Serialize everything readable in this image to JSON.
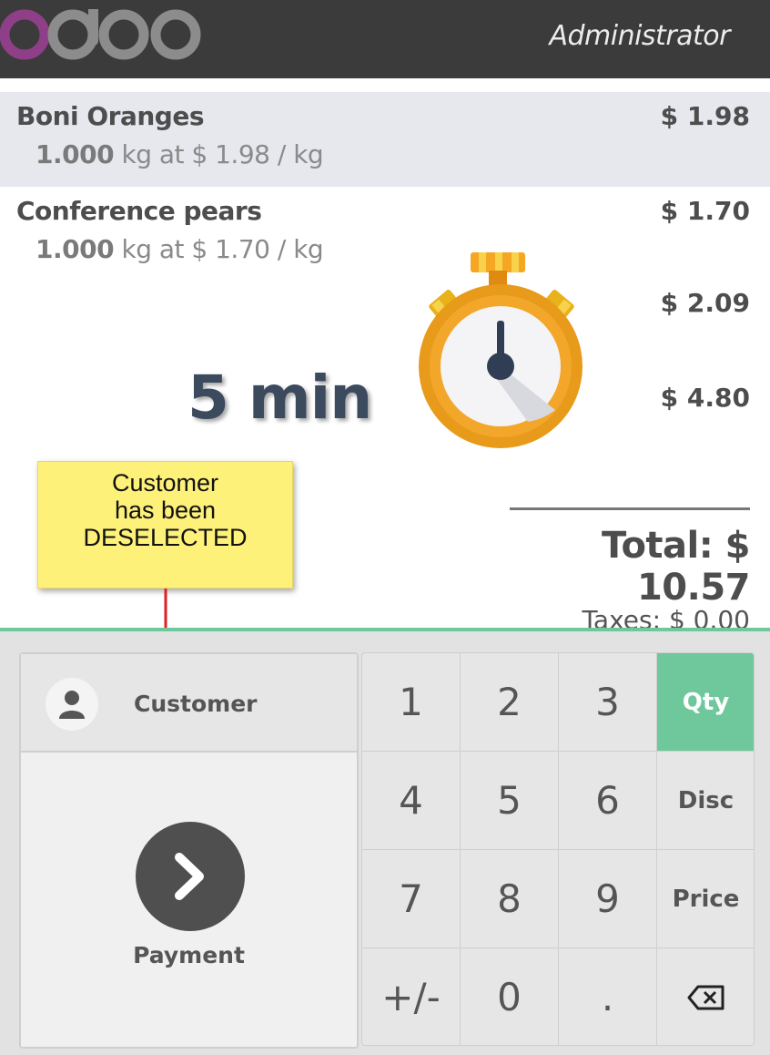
{
  "header": {
    "brand": "odoo",
    "user": "Administrator"
  },
  "order": {
    "lines": [
      {
        "name": "Boni Oranges",
        "price": "$ 1.98",
        "qty": "1.000",
        "detail": " kg at $ 1.98 / kg",
        "selected": true
      },
      {
        "name": "Conference pears",
        "price": "$ 1.70",
        "qty": "1.000",
        "detail": " kg at $ 1.70 / kg",
        "selected": false
      }
    ],
    "extra_prices": [
      "$ 2.09",
      "$ 4.80"
    ],
    "total": "Total: $ 10.57",
    "taxes": "Taxes: $ 0.00"
  },
  "overlay": {
    "time_text": "5 min",
    "note": "Customer\nhas been\nDESELECTED"
  },
  "actions": {
    "customer_label": "Customer",
    "payment_label": "Payment"
  },
  "numpad": {
    "keys": [
      [
        "1",
        "2",
        "3",
        "Qty"
      ],
      [
        "4",
        "5",
        "6",
        "Disc"
      ],
      [
        "7",
        "8",
        "9",
        "Price"
      ],
      [
        "+/-",
        "0",
        ".",
        "⌫"
      ]
    ],
    "active_mode": "Qty"
  },
  "colors": {
    "accent": "#6ec89b",
    "topbar": "#3b3b3b",
    "logo_o": "#8f3f87",
    "logo_grey": "#8c8c8c",
    "note": "#fef17a",
    "arrow": "#e02020",
    "stopwatch": "#f0a51f"
  },
  "icons": {
    "avatar": "user-icon",
    "payment": "chevron-right-icon",
    "backspace": "backspace-icon",
    "timer": "stopwatch-icon"
  }
}
